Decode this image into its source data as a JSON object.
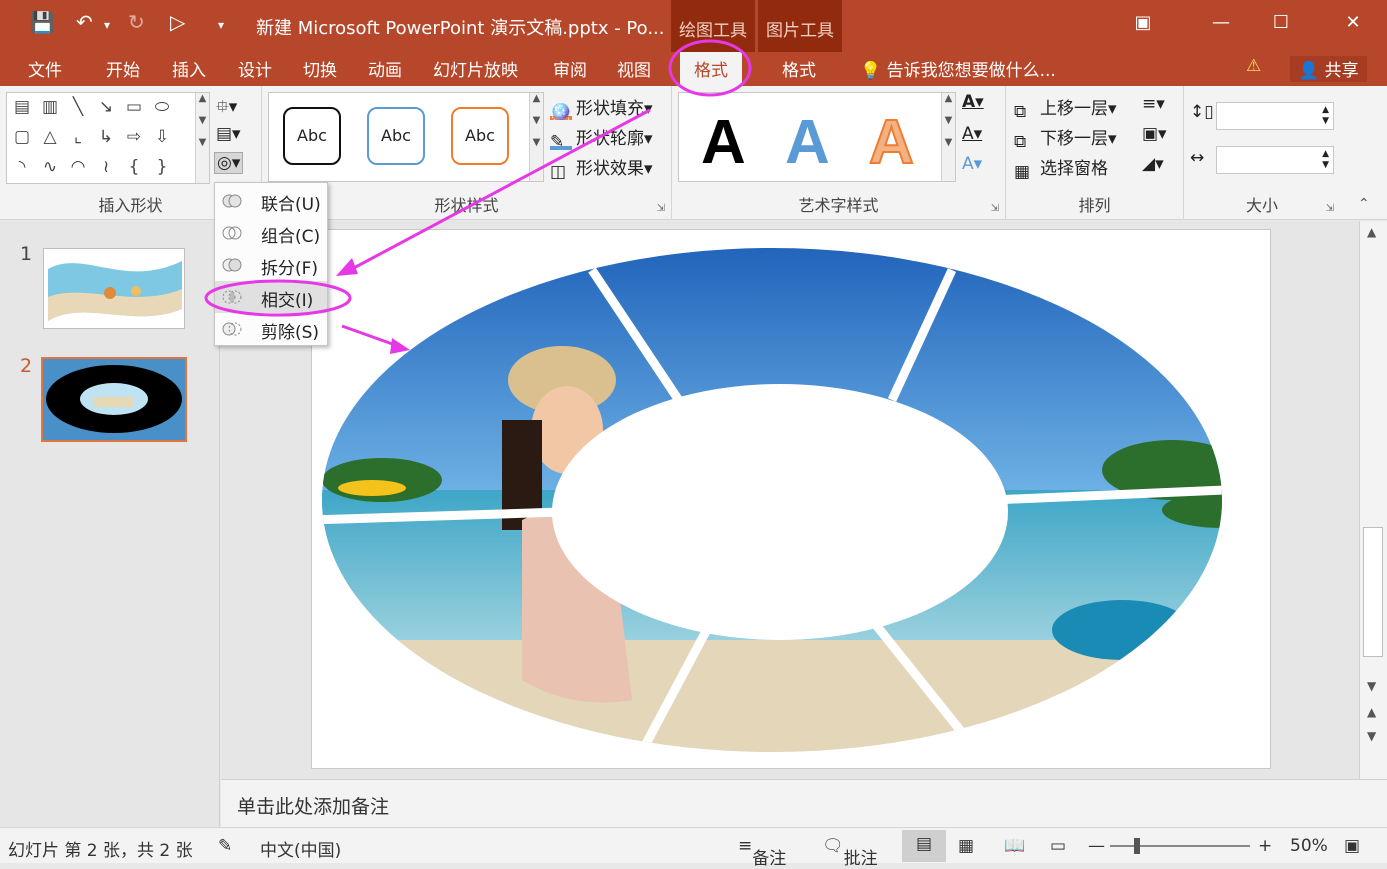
{
  "window": {
    "title": "新建 Microsoft PowerPoint 演示文稿.pptx - Po...",
    "context_tabs": [
      "绘图工具",
      "图片工具"
    ]
  },
  "tabs": [
    "文件",
    "开始",
    "插入",
    "设计",
    "切换",
    "动画",
    "幻灯片放映",
    "审阅",
    "视图",
    "格式",
    "格式"
  ],
  "active_tab_index": 9,
  "tell_me": "告诉我您想要做什么...",
  "share": "共享",
  "ribbon": {
    "insert_shapes": {
      "label": "插入形状"
    },
    "shape_styles": {
      "label": "形状样式",
      "presets": [
        "Abc",
        "Abc",
        "Abc"
      ],
      "preset_colors": [
        "#111111",
        "#5b9bd5",
        "#ed7d31"
      ],
      "fill": "形状填充",
      "outline": "形状轮廓",
      "effects": "形状效果"
    },
    "wordart": {
      "label": "艺术字样式",
      "letter": "A",
      "letter_colors": [
        "#000000",
        "#5b9bd5",
        "#ed7d31"
      ]
    },
    "arrange": {
      "label": "排列",
      "bring_forward": "上移一层",
      "send_backward": "下移一层",
      "selection_pane": "选择窗格"
    },
    "size": {
      "label": "大小",
      "height": "",
      "width": ""
    }
  },
  "merge_menu": {
    "items": [
      "联合(U)",
      "组合(C)",
      "拆分(F)",
      "相交(I)",
      "剪除(S)"
    ],
    "highlighted_index": 3
  },
  "slides": {
    "numbers": [
      "1",
      "2"
    ],
    "selected_index": 1
  },
  "notes_placeholder": "单击此处添加备注",
  "status": {
    "slide_info": "幻灯片 第 2 张，共 2 张",
    "language": "中文(中国)",
    "notes": "备注",
    "comments": "批注",
    "zoom": "50%"
  },
  "colors": {
    "brand": "#b7472a",
    "annotation": "#e638e6"
  }
}
